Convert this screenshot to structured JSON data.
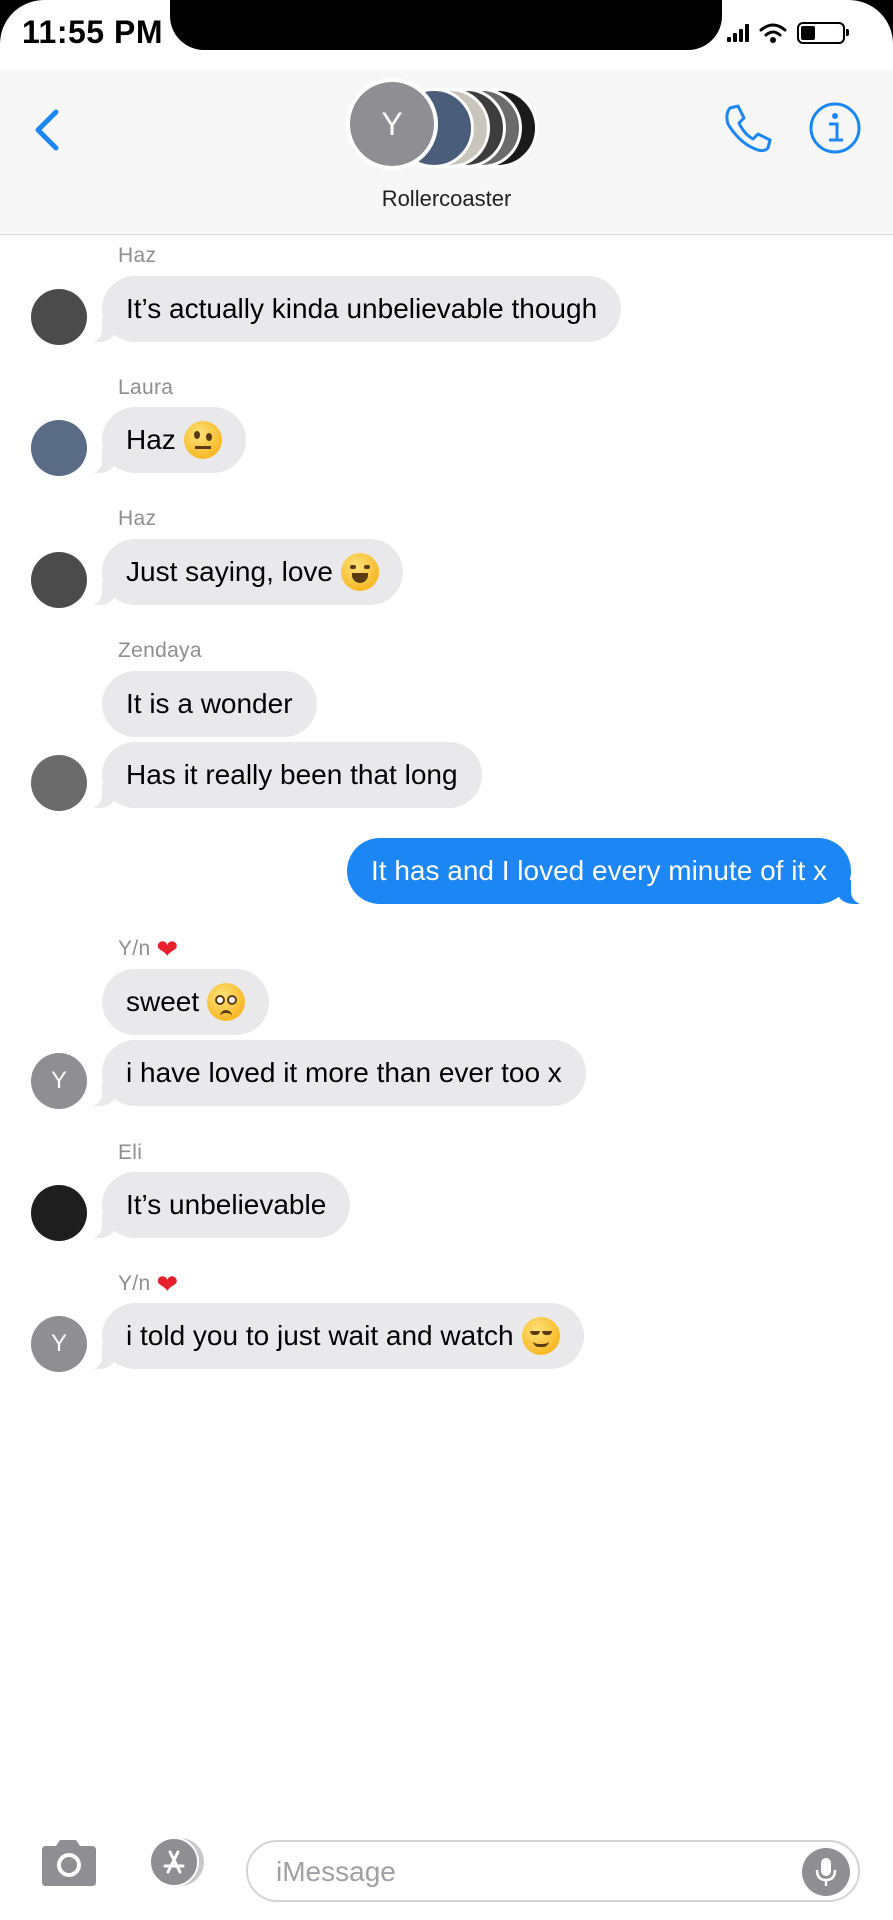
{
  "status_bar": {
    "time": "11:55 PM"
  },
  "header": {
    "group_name": "Rollercoaster",
    "main_avatar_letter": "Y"
  },
  "messages": [
    {
      "sender": "Haz",
      "text": "It’s actually kinda unbelievable though"
    },
    {
      "sender": "Laura",
      "text": "Haz",
      "emoji": "face-with-raised-eyebrow"
    },
    {
      "sender": "Haz",
      "text": "Just saying, love",
      "emoji": "grinning-squinting-face"
    },
    {
      "sender": "Zendaya",
      "text": "It is a wonder"
    },
    {
      "sender": "Zendaya",
      "text": "Has it really been that long"
    },
    {
      "sender": "me",
      "text": "It has and I loved every minute of it x"
    },
    {
      "sender": "Y/n",
      "text": "sweet",
      "emoji": "pleading-face"
    },
    {
      "sender": "Y/n",
      "text": "i have loved it more than ever too x",
      "avatar_letter": "Y"
    },
    {
      "sender": "Eli",
      "text": "It’s unbelievable"
    },
    {
      "sender": "Y/n",
      "text": "i told you to just wait and watch",
      "emoji": "relieved-face",
      "avatar_letter": "Y"
    }
  ],
  "input": {
    "placeholder": "iMessage"
  },
  "colors": {
    "accent": "#1c86f5",
    "incoming_bubble": "#e9e9eb",
    "heart": "#e8202d"
  }
}
